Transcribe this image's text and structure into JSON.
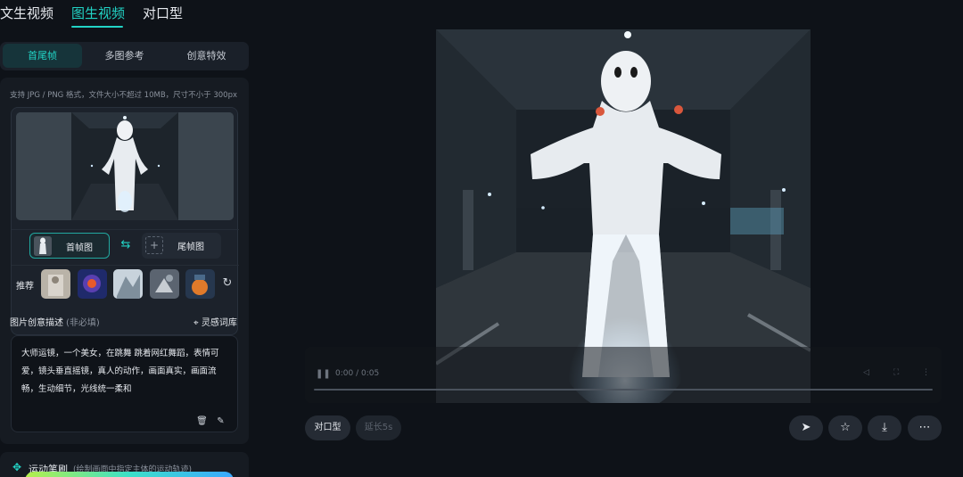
{
  "top_tabs": [
    {
      "label": "文生视频",
      "active": false
    },
    {
      "label": "图生视频",
      "active": true
    },
    {
      "label": "对口型",
      "active": false
    }
  ],
  "sub_tabs": [
    {
      "label": "首尾帧",
      "active": true
    },
    {
      "label": "多图参考",
      "active": false
    },
    {
      "label": "创意特效",
      "active": false
    }
  ],
  "upload": {
    "hint": "支持 JPG / PNG 格式，文件大小不超过 10MB，尺寸不小于 300px",
    "first_frame_label": "首帧图",
    "last_frame_label": "尾帧图",
    "plus": "+",
    "recommend_label": "推荐"
  },
  "description": {
    "label": "图片创意描述",
    "optional": "(非必填)",
    "library_link": "灵感词库",
    "text": "大师运镜，一个美女，在跳舞 跳着网红舞蹈，表情可爱，镜头垂直摇镜，真人的动作，画面真实，画面流畅，生动细节，光线统一柔和"
  },
  "motion": {
    "title": "运动笔刷",
    "subtitle": "(绘制画面中指定主体的运动轨迹)"
  },
  "player": {
    "time": "0:00 / 0:05"
  },
  "actions": {
    "lip_sync_label": "对口型",
    "extend_label": "延长5s"
  },
  "colors": {
    "accent": "#22d3c5",
    "background": "#0e1218",
    "panel": "#161b22"
  }
}
